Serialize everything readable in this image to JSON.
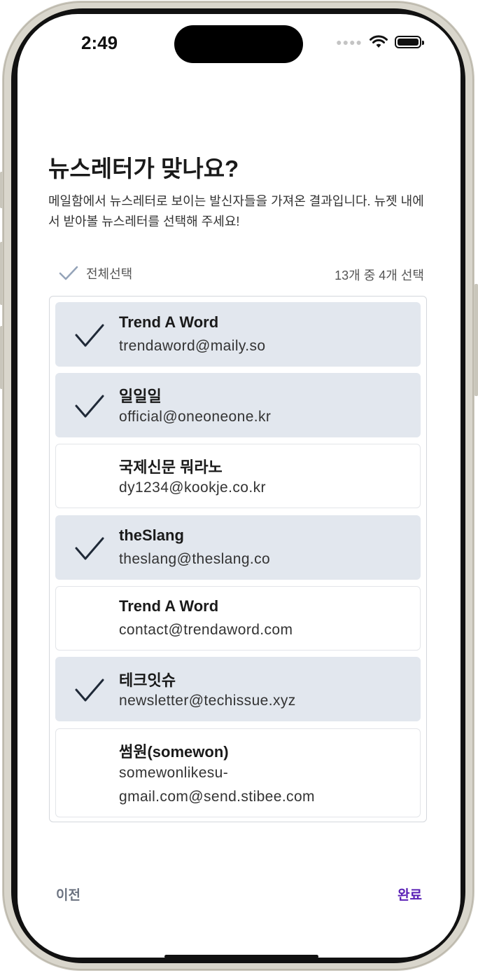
{
  "status": {
    "time": "2:49"
  },
  "header": {
    "title": "뉴스레터가 맞나요?",
    "description": "메일함에서 뉴스레터로 보이는 발신자들을 가져온 결과입니다. 뉴젯 내에서 받아볼 뉴스레터를 선택해 주세요!"
  },
  "selection": {
    "select_all_label": "전체선택",
    "count_label": "13개 중 4개 선택"
  },
  "newsletters": [
    {
      "name": "Trend A Word",
      "email": "trendaword@maily.so",
      "checked": true
    },
    {
      "name": "일일일",
      "email": "official@oneoneone.kr",
      "checked": true
    },
    {
      "name": "국제신문 뭐라노",
      "email": "dy1234@kookje.co.kr",
      "checked": false
    },
    {
      "name": "theSlang",
      "email": "theslang@theslang.co",
      "checked": true
    },
    {
      "name": "Trend A Word",
      "email": "contact@trendaword.com",
      "checked": false
    },
    {
      "name": "테크잇슈",
      "email": "newsletter@techissue.xyz",
      "checked": true
    },
    {
      "name": "썸원(somewon)",
      "email": "somewonlikesu-gmail.com@send.stibee.com",
      "checked": false
    }
  ],
  "footer": {
    "prev_label": "이전",
    "done_label": "완료"
  },
  "colors": {
    "accent": "#5b21b6",
    "checked_bg": "#e2e7ee",
    "check_stroke": "#1f2937",
    "select_all_check": "#94a3b8"
  }
}
